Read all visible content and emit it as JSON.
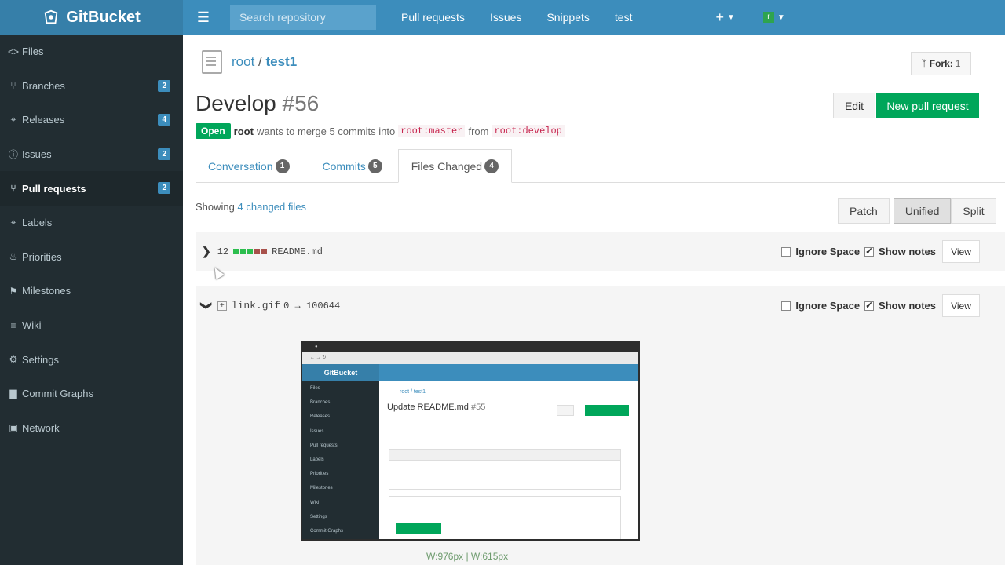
{
  "brand": {
    "name": "GitBucket"
  },
  "header": {
    "search_placeholder": "Search repository",
    "nav": [
      "Pull requests",
      "Issues",
      "Snippets",
      "test"
    ],
    "plus": "+",
    "avatar_letter": "r"
  },
  "sidebar": {
    "items": [
      {
        "label": "Files",
        "icon": "code-icon",
        "glyph": "<>",
        "badge": ""
      },
      {
        "label": "Branches",
        "icon": "branch-icon",
        "glyph": "⑂",
        "badge": "2"
      },
      {
        "label": "Releases",
        "icon": "tag-icon",
        "glyph": "⌖",
        "badge": "4"
      },
      {
        "label": "Issues",
        "icon": "issue-icon",
        "glyph": "ⓘ",
        "badge": "2"
      },
      {
        "label": "Pull requests",
        "icon": "pull-request-icon",
        "glyph": "⑂",
        "badge": "2",
        "active": true
      },
      {
        "label": "Labels",
        "icon": "label-icon",
        "glyph": "⌖",
        "badge": ""
      },
      {
        "label": "Priorities",
        "icon": "flame-icon",
        "glyph": "♨",
        "badge": ""
      },
      {
        "label": "Milestones",
        "icon": "milestone-icon",
        "glyph": "⚑",
        "badge": ""
      },
      {
        "label": "Wiki",
        "icon": "wiki-icon",
        "glyph": "≡",
        "badge": ""
      },
      {
        "label": "Settings",
        "icon": "gear-icon",
        "glyph": "⚙",
        "badge": ""
      },
      {
        "label": "Commit Graphs",
        "icon": "graph-icon",
        "glyph": "▇",
        "badge": ""
      },
      {
        "label": "Network",
        "icon": "network-icon",
        "glyph": "▣",
        "badge": ""
      }
    ]
  },
  "repo": {
    "owner": "root",
    "separator": " / ",
    "name": "test1"
  },
  "fork": {
    "label": "Fork:",
    "count": "1"
  },
  "pr": {
    "title": "Develop",
    "number": "#56",
    "status": "Open",
    "author": "root",
    "merge_text": "wants to merge 5 commits into",
    "base": "root:master",
    "from_text": "from",
    "head": "root:develop"
  },
  "actions": {
    "edit": "Edit",
    "new_pr": "New pull request"
  },
  "tabs": [
    {
      "label": "Conversation",
      "count": "1"
    },
    {
      "label": "Commits",
      "count": "5"
    },
    {
      "label": "Files Changed",
      "count": "4",
      "active": true
    }
  ],
  "files": {
    "showing_prefix": "Showing",
    "changed_link": "4 changed files",
    "view_modes": [
      "Patch",
      "Unified",
      "Split"
    ],
    "ignore_space": "Ignore Space",
    "show_notes": "Show notes",
    "view": "View",
    "list": [
      {
        "changes": "12",
        "name": "README.md",
        "collapsed": true
      },
      {
        "name": "link.gif",
        "mode": "0 → 100644",
        "collapsed": false
      }
    ],
    "image_dims": "W:976px | W:615px"
  },
  "preview": {
    "brand": "GitBucket",
    "repo": "root / test1",
    "title": "Update README.md",
    "number": "#55",
    "sidebar": [
      "Files",
      "Branches",
      "Releases",
      "Issues",
      "Pull requests",
      "Labels",
      "Priorities",
      "Milestones",
      "Wiki",
      "Settings",
      "Commit Graphs"
    ]
  },
  "colors": {
    "header": "#3c8dbc",
    "sidebar": "#222d32",
    "green": "#00a65a"
  }
}
